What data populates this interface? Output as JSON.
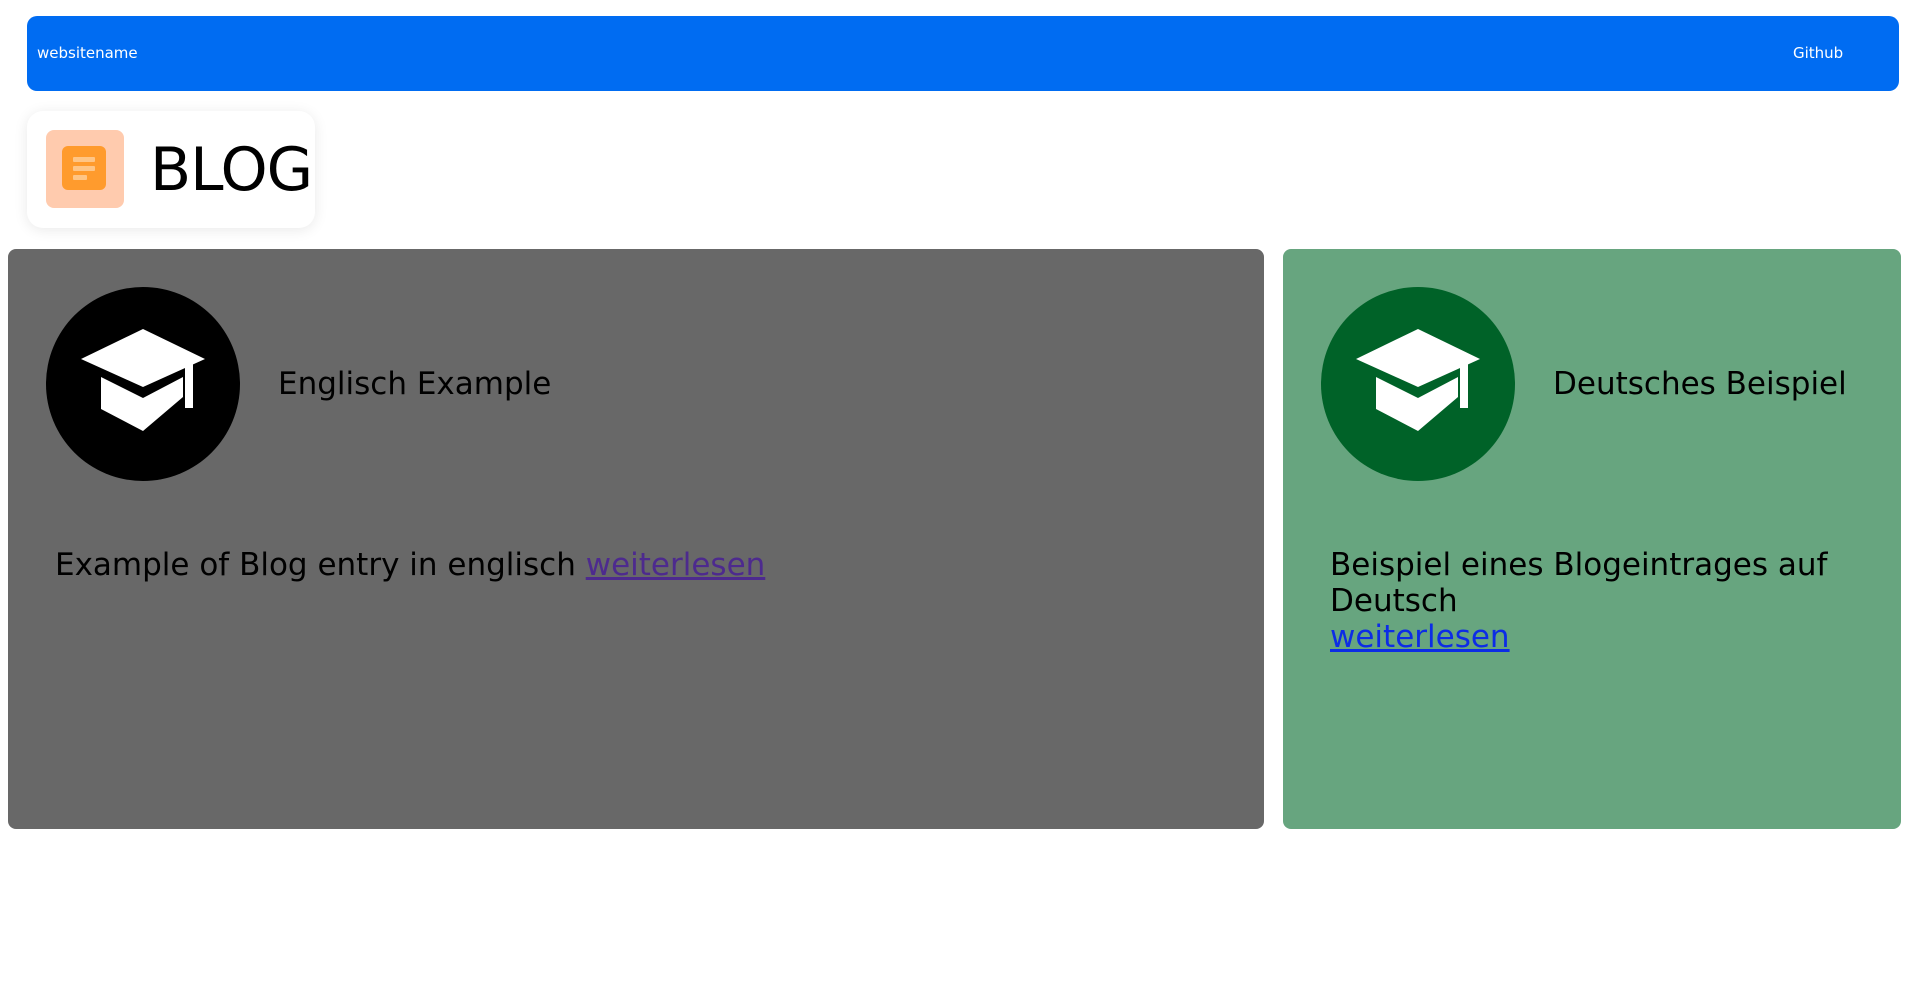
{
  "navbar": {
    "brand": "websitename",
    "link": "Github",
    "background": "#006cf2"
  },
  "blog_chip": {
    "title": "BLOG",
    "icon": "document-icon",
    "icon_bg": "#ffcbae",
    "icon_fg": "#ff9b2d"
  },
  "cards": [
    {
      "title": "Englisch Example",
      "text": "Example of Blog entry in englisch",
      "link": "weiterlesen",
      "link_color": "#4d2a8e",
      "background": "#686868",
      "avatar_background": "#000000",
      "icon": "graduation-cap-icon"
    },
    {
      "title": "Deutsches Beispiel",
      "text": "Beispiel eines Blogeintrages auf Deutsch",
      "link": "weiterlesen",
      "link_color": "#0c2ce6",
      "background": "#67a57f",
      "avatar_background": "#006228",
      "icon": "graduation-cap-icon"
    }
  ]
}
